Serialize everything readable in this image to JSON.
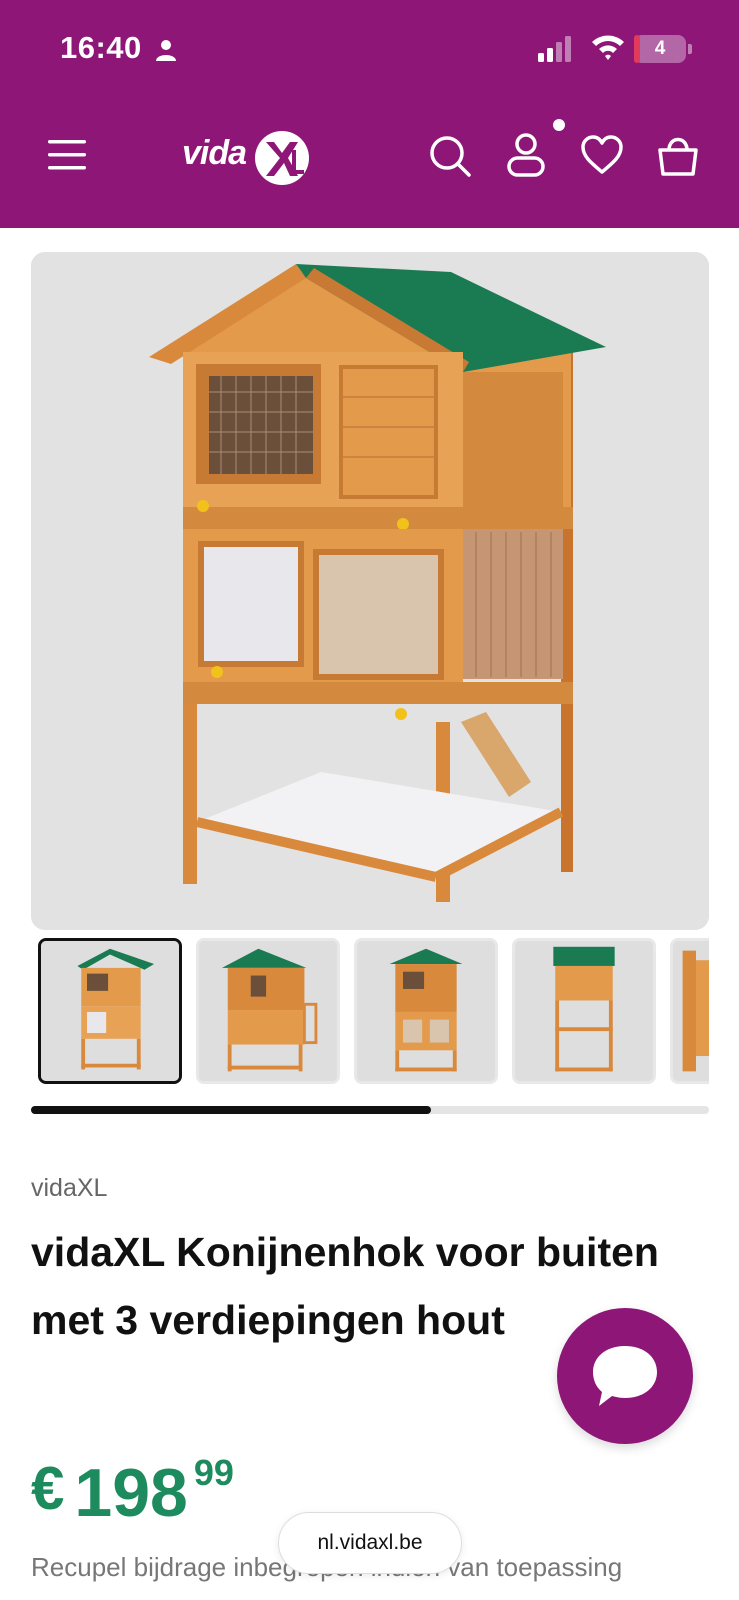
{
  "status_bar": {
    "time": "16:40",
    "battery_level": "4",
    "battery_percent": 0.12,
    "icons": [
      "person-icon",
      "signal-icon",
      "wifi-icon",
      "battery-icon"
    ]
  },
  "header": {
    "logo_text": "vida",
    "icons": [
      "menu-icon",
      "vidaxl-logo",
      "search-icon",
      "account-icon",
      "heart-icon",
      "cart-icon"
    ],
    "background_color": "#8d1677"
  },
  "gallery": {
    "main_image_alt": "vidaXL Konijnenhok voor buiten met 3 verdiepingen hout",
    "thumbnail_count": 5,
    "active_thumbnail": 1,
    "scroll_progress": 0.59
  },
  "product": {
    "brand": "vidaXL",
    "title": "vidaXL Konijnenhok voor buiten met 3 verdiepingen hout",
    "price_currency": "€",
    "price_integer": "198",
    "price_decimals": "99",
    "price_color": "#1d8b5e",
    "recupel_note": "Recupel bijdrage inbegrepen indien van toepassing"
  },
  "chat": {
    "icon": "chat-bubble-icon"
  },
  "browser": {
    "url": "nl.vidaxl.be"
  }
}
